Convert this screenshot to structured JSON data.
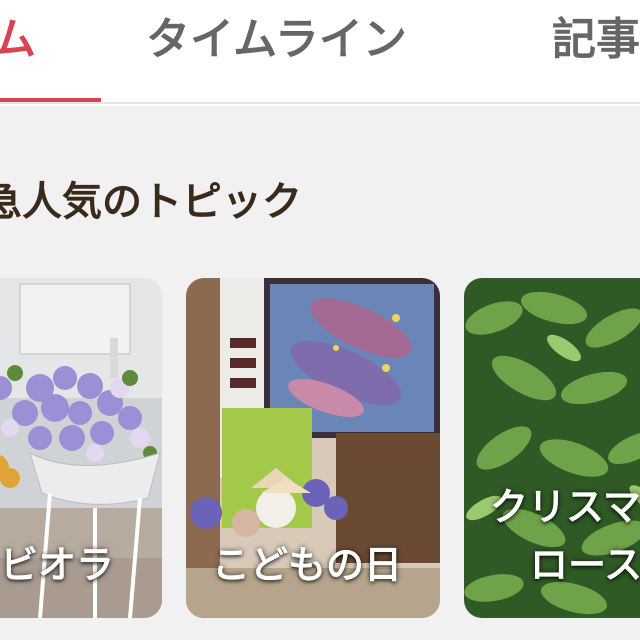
{
  "tabs": [
    {
      "label": "ム",
      "active": true
    },
    {
      "label": "タイムライン",
      "active": false
    },
    {
      "label": "記事",
      "active": false
    }
  ],
  "section": {
    "title": "急人気のトピック"
  },
  "topics": [
    {
      "label": "ビオラ"
    },
    {
      "label": "こどもの日"
    },
    {
      "label_line1": "クリスマ",
      "label_line2": "ロース"
    }
  ],
  "colors": {
    "accent": "#d9434f",
    "tab_inactive": "#666666",
    "title": "#3a2a1a"
  }
}
